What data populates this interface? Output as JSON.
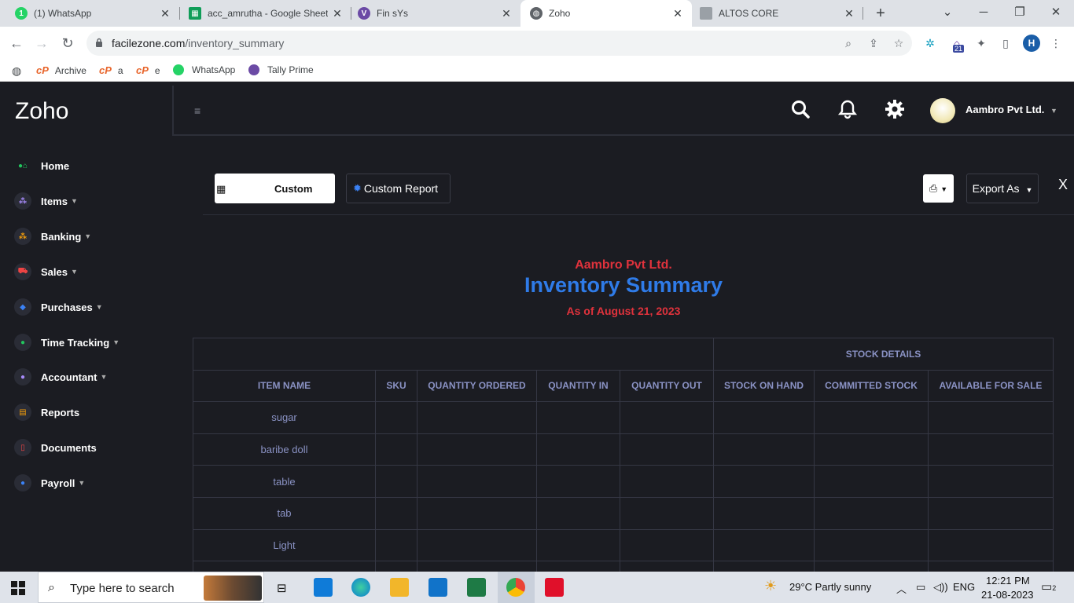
{
  "browser": {
    "tabs": [
      {
        "title": "(1) WhatsApp",
        "favicon": "whatsapp-icon",
        "color": "#25d366",
        "active": false
      },
      {
        "title": "acc_amrutha - Google Sheets",
        "favicon": "sheets-icon",
        "color": "#0f9d58",
        "active": false
      },
      {
        "title": "Fin sYs",
        "favicon": "finsys-icon",
        "color": "#6b4aa5",
        "active": false
      },
      {
        "title": "Zoho",
        "favicon": "globe-icon",
        "color": "#5f6368",
        "active": true
      },
      {
        "title": "ALTOS CORE",
        "favicon": "altos-icon",
        "color": "#9aa0a6",
        "active": false
      }
    ],
    "url_domain": "facilezone.com",
    "url_path": "/inventory_summary",
    "profile_initial": "H",
    "extension_badge": "21",
    "bookmarks": [
      {
        "label": "Archive"
      },
      {
        "label": "a"
      },
      {
        "label": "e"
      },
      {
        "label": "WhatsApp"
      },
      {
        "label": "Tally Prime"
      }
    ]
  },
  "app": {
    "brand": "Zoho",
    "company": "Aambro Pvt Ltd.",
    "nav": [
      {
        "label": "Home",
        "icon": "home-icon",
        "color": "#22c55e",
        "caret": false
      },
      {
        "label": "Items",
        "icon": "items-icon",
        "color": "#a78bfa",
        "caret": true
      },
      {
        "label": "Banking",
        "icon": "bank-icon",
        "color": "#f59e0b",
        "caret": true
      },
      {
        "label": "Sales",
        "icon": "cart-icon",
        "color": "#ef4444",
        "caret": true
      },
      {
        "label": "Purchases",
        "icon": "basket-icon",
        "color": "#3b82f6",
        "caret": true
      },
      {
        "label": "Time Tracking",
        "icon": "clock-icon",
        "color": "#22c55e",
        "caret": true
      },
      {
        "label": "Accountant",
        "icon": "person-icon",
        "color": "#a78bfa",
        "caret": true
      },
      {
        "label": "Reports",
        "icon": "report-icon",
        "color": "#f59e0b",
        "caret": false
      },
      {
        "label": "Documents",
        "icon": "document-icon",
        "color": "#ef4444",
        "caret": false
      },
      {
        "label": "Payroll",
        "icon": "payroll-icon",
        "color": "#3b82f6",
        "caret": true
      }
    ]
  },
  "toolbar": {
    "date_filter_label": "Custom",
    "custom_report_label": "Custom Report",
    "export_label": "Export As",
    "close_label": "X"
  },
  "report": {
    "company": "Aambro Pvt Ltd.",
    "title": "Inventory Summary",
    "as_of": "As of August 21, 2023",
    "group_header": "STOCK DETAILS",
    "columns": [
      "ITEM NAME",
      "SKU",
      "QUANTITY ORDERED",
      "QUANTITY IN",
      "QUANTITY OUT",
      "STOCK ON HAND",
      "COMMITTED STOCK",
      "AVAILABLE FOR SALE"
    ],
    "rows": [
      {
        "item": "sugar"
      },
      {
        "item": "baribe doll"
      },
      {
        "item": "table"
      },
      {
        "item": "tab"
      },
      {
        "item": "Light"
      },
      {
        "item": ""
      }
    ]
  },
  "taskbar": {
    "search_placeholder": "Type here to search",
    "weather": "29°C  Partly sunny",
    "language": "ENG",
    "time": "12:21 PM",
    "date": "21-08-2023",
    "notifications": "2"
  }
}
